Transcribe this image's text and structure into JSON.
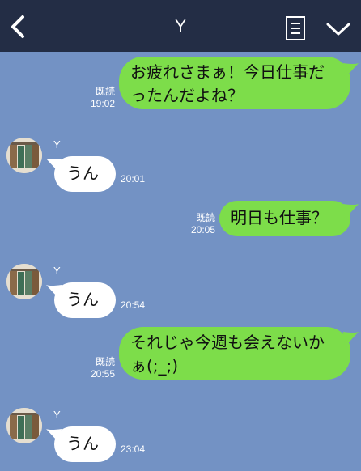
{
  "header": {
    "title": "Y",
    "back_icon": "chevron-left-icon",
    "notes_icon": "notes-icon",
    "menu_icon": "chevron-down-icon"
  },
  "colors": {
    "header_bg": "#232d45",
    "chat_bg": "#7392c4",
    "sent_bubble": "#7ddd4a",
    "received_bubble": "#ffffff"
  },
  "messages": [
    {
      "direction": "sent",
      "text_line1": "お疲れさまぁ！今日仕事だ",
      "text_line2": "ったんだよね？",
      "read": "既読",
      "time": "19:02"
    },
    {
      "direction": "received",
      "sender": "Y",
      "text": "うん",
      "time": "20:01"
    },
    {
      "direction": "sent",
      "text": "明日も仕事？",
      "read": "既読",
      "time": "20:05"
    },
    {
      "direction": "received",
      "sender": "Y",
      "text": "うん",
      "time": "20:54"
    },
    {
      "direction": "sent",
      "text_line1": "それじゃ今週も会えないか",
      "text_line2": "ぁ(;_;)",
      "read": "既読",
      "time": "20:55"
    },
    {
      "direction": "received",
      "sender": "Y",
      "text": "うん",
      "time": "23:04"
    }
  ]
}
